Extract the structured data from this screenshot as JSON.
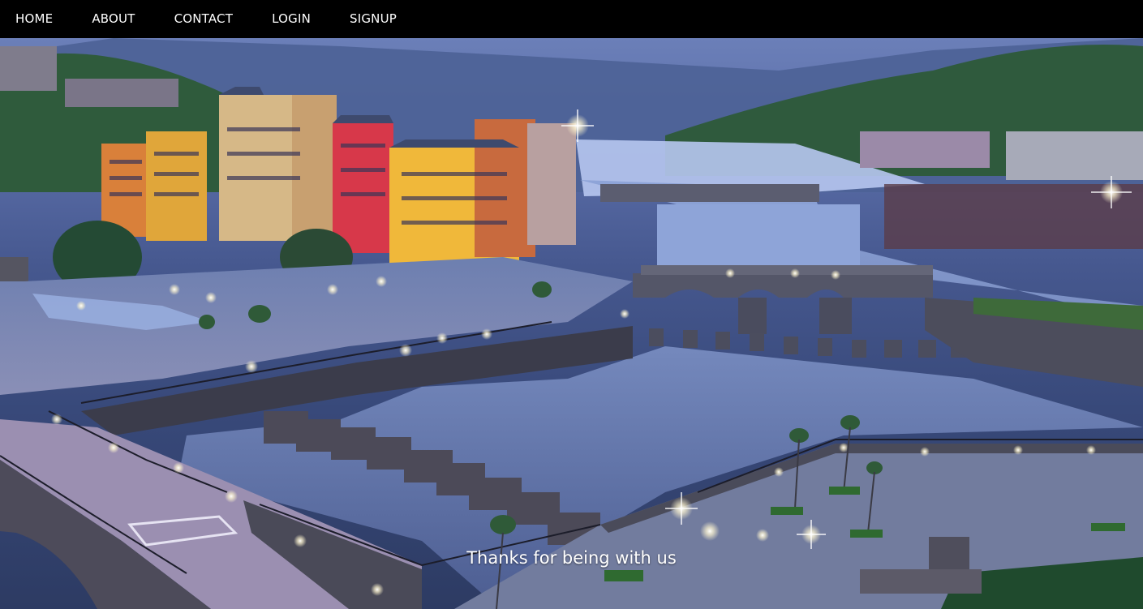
{
  "nav": {
    "items": [
      {
        "label": "HOME"
      },
      {
        "label": "ABOUT"
      },
      {
        "label": "CONTACT"
      },
      {
        "label": "LOGIN"
      },
      {
        "label": "SIGNUP"
      }
    ]
  },
  "hero": {
    "caption": "Thanks for being with us"
  },
  "colors": {
    "navbar_bg": "#000000",
    "nav_text": "#ffffff",
    "caption_text": "#ffffff"
  }
}
